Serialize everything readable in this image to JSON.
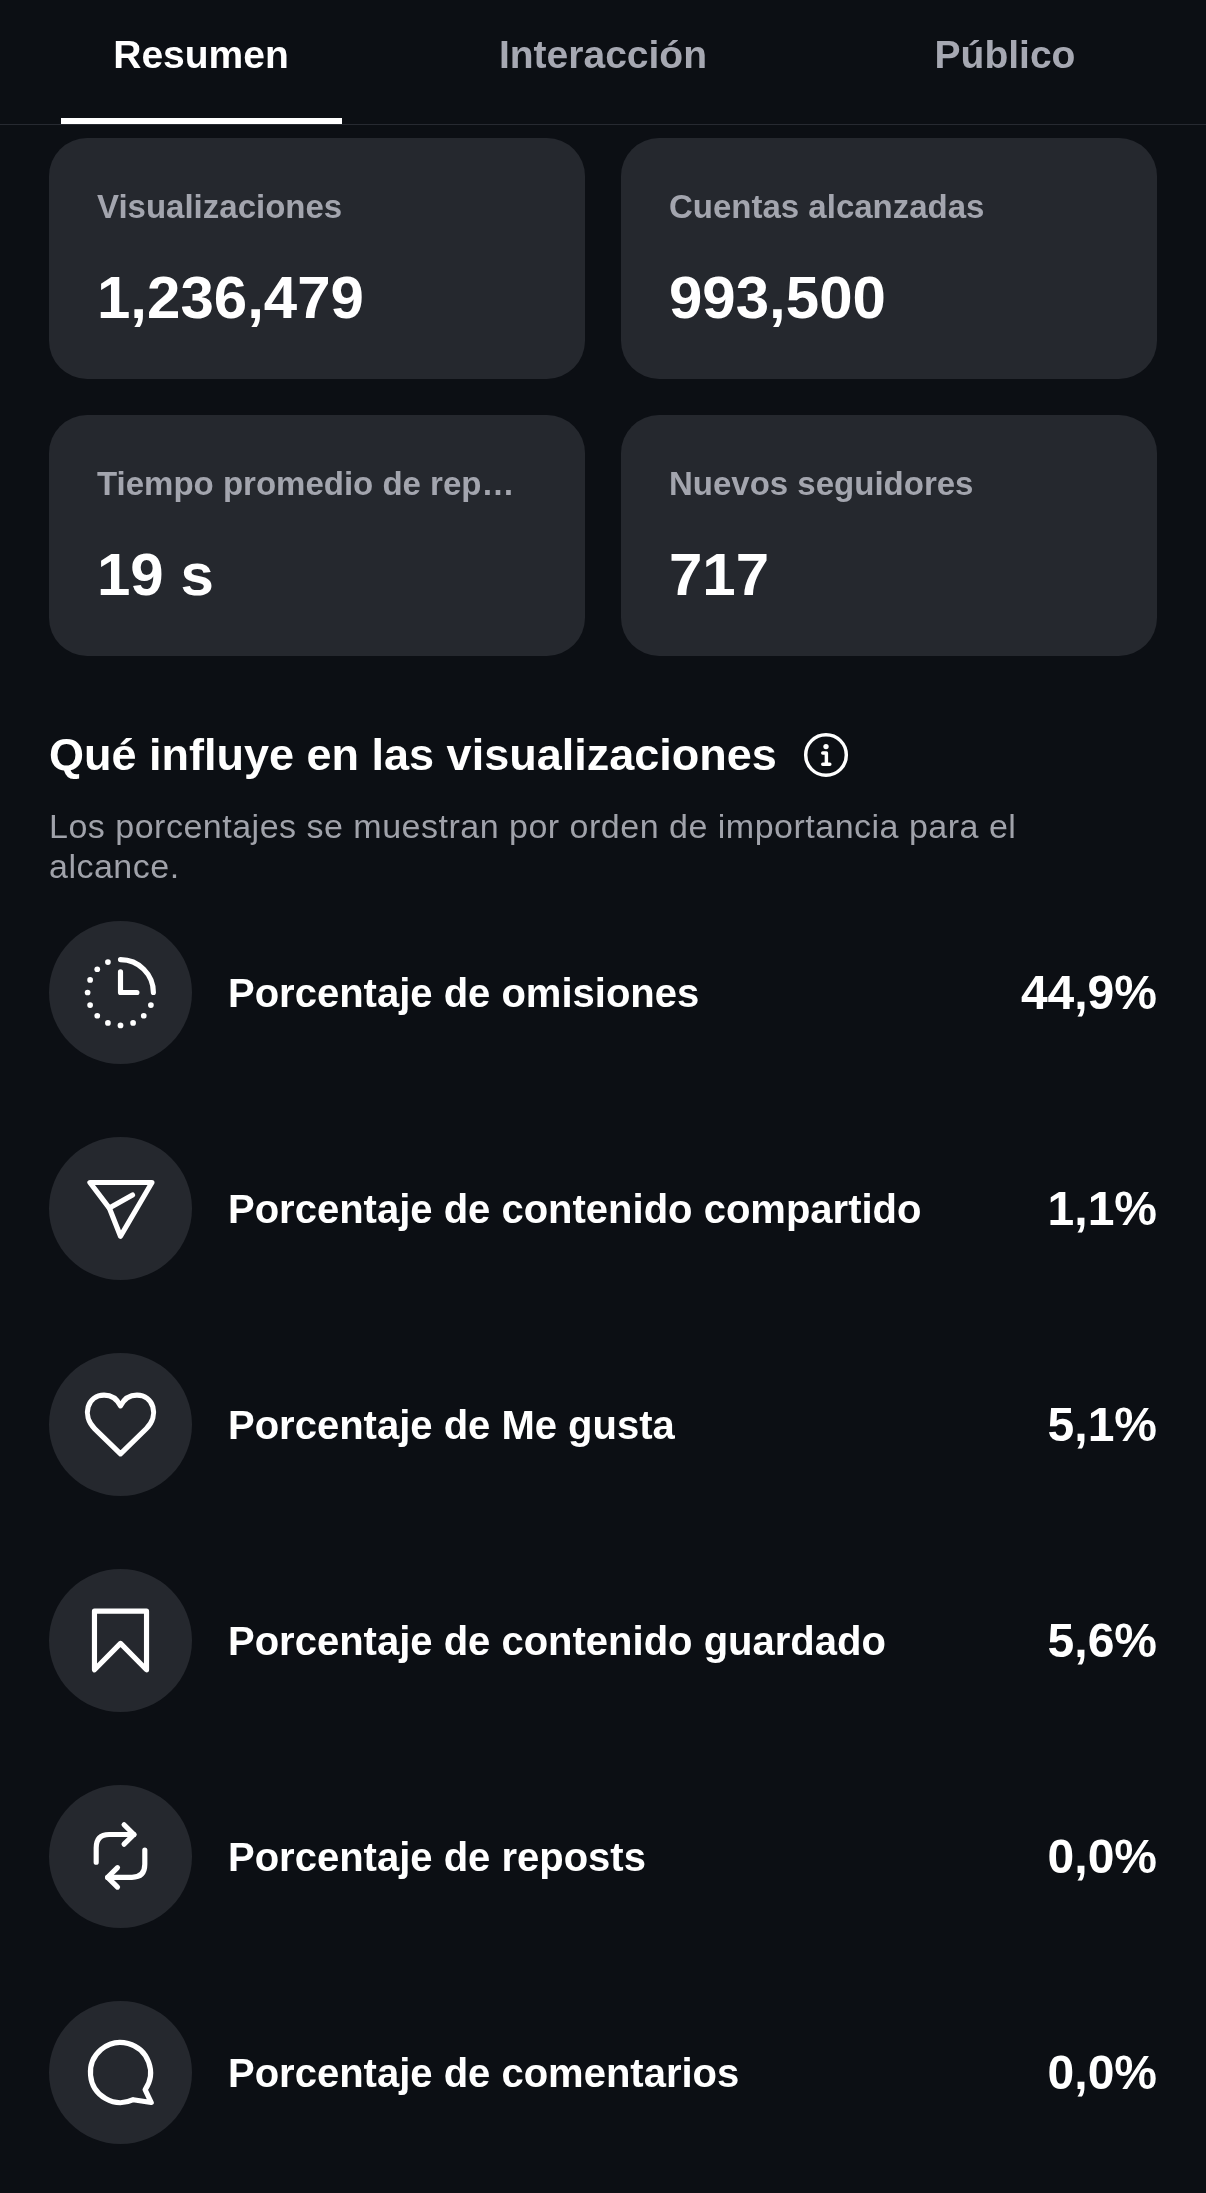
{
  "tabs": [
    {
      "label": "Resumen",
      "selected": true
    },
    {
      "label": "Interacción",
      "selected": false
    },
    {
      "label": "Público",
      "selected": false
    }
  ],
  "stats": [
    {
      "label": "Visualizaciones",
      "value": "1,236,479"
    },
    {
      "label": "Cuentas alcanzadas",
      "value": "993,500"
    },
    {
      "label": "Tiempo promedio de rep…",
      "value": "19 s"
    },
    {
      "label": "Nuevos seguidores",
      "value": "717"
    }
  ],
  "influence": {
    "title": "Qué influye en las visualizaciones",
    "description": "Los porcentajes se muestran por orden de importancia para el alcance.",
    "factors": [
      {
        "kind": "skip",
        "label": "Porcentaje de omisiones",
        "value": "44,9%"
      },
      {
        "kind": "share",
        "label": "Porcentaje de contenido compartido",
        "value": "1,1%"
      },
      {
        "kind": "like",
        "label": "Porcentaje de Me gusta",
        "value": "5,1%"
      },
      {
        "kind": "save",
        "label": "Porcentaje de contenido guardado",
        "value": "5,6%"
      },
      {
        "kind": "repost",
        "label": "Porcentaje de reposts",
        "value": "0,0%"
      },
      {
        "kind": "comment",
        "label": "Porcentaje de comentarios",
        "value": "0,0%"
      }
    ]
  }
}
